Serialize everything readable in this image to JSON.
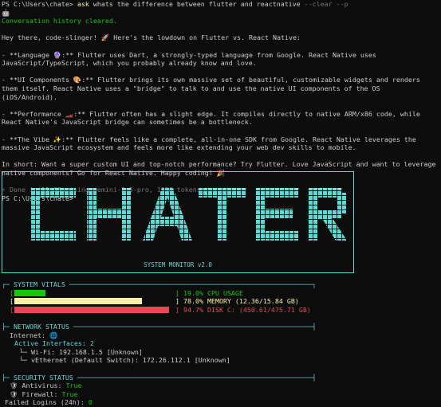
{
  "terminal": {
    "prompt": "PS C:\\Users\\chate>",
    "command": "ask",
    "question": "whats the difference between flutter and reactnative",
    "flags": "--clear --p",
    "emoji_line": "🤖",
    "cleared_msg": "Conversation history cleared.",
    "response": [
      "Hey there, code-slinger! 🚀 Here's the lowdown on Flutter vs. React Native:",
      "- **Language 🔮:** Flutter uses Dart, a strongly-typed language from Google. React Native uses JavaScript/TypeScript, which you probably already know and love.",
      "- **UI Components 🎨:** Flutter brings its own massive set of beautiful, customizable widgets and renders them itself. React Native uses a \"bridge\" to talk to and use the native UI components of the OS (iOS/Android).",
      "- **Performance 🏎️:** Flutter often has a slight edge. It compiles directly to native ARM/x86 code, while React Native's JavaScript bridge can sometimes be a bottleneck.",
      "- **The Vibe ✨:** Flutter feels like a complete, all-in-one SDK from Google. React Native leverages the massive JavaScript ecosystem and feels more like extending your web dev skills to mobile.",
      "In short: Want a super custom UI and top-notch performance? Try Flutter. Love JavaScript and want to leverage native components? Go for React Native. Happy coding! 🎉"
    ],
    "done_line": "⚡ Done in 11.05s using gemini-2.5-pro, 1950 tokens",
    "prompt2": "PS C:\\Users\\chate>"
  },
  "banner": {
    "title": "CHATER",
    "subtitle": "SYSTEM MONITOR v2.0"
  },
  "vitals": {
    "header": "┌─ SYSTEM VITALS ─────────────────────────────────────────────────────────────┐",
    "cpu": {
      "label": "] 19.0% CPU USAGE",
      "percent": 19.0,
      "color": "#16c60c"
    },
    "mem": {
      "label": "] 78.0% MEMORY (12.36/15.84 GB)",
      "percent": 78.0,
      "color": "#f9f1a5"
    },
    "disk": {
      "label": "] 94.7% DISK C: (450.61/475.71 GB)",
      "percent": 94.7,
      "color": "#e74856"
    }
  },
  "network": {
    "header": "├─ NETWORK STATUS ────────────────────────────────────────────────────────────┤",
    "internet": "Internet: 🌐",
    "interfaces": "Active Interfaces: 2",
    "wifi": "└─ Wi-Fi: 192.168.1.5 [Unknown]",
    "vether": "└─ vEthernet (Default Switch): 172.26.112.1 [Unknown]"
  },
  "security": {
    "header": "├─ SECURITY STATUS ───────────────────────────────────────────────────────────┤",
    "antivirus_label": "🛡 Antivirus: ",
    "antivirus_value": "True",
    "firewall_label": "🛡 Firewall: ",
    "firewall_value": "True",
    "logins_label": "Failed Logins (24h): ",
    "logins_value": "0"
  }
}
